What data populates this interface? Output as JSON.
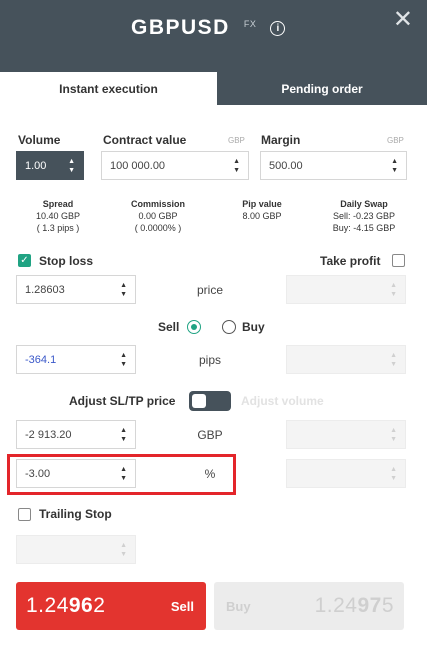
{
  "header": {
    "symbol": "GBPUSD",
    "badge": "FX",
    "info_glyph": "i",
    "close_glyph": "✕"
  },
  "tabs": [
    {
      "label": "Instant execution",
      "active": true
    },
    {
      "label": "Pending order",
      "active": false
    }
  ],
  "volume": {
    "label": "Volume",
    "value": "1.00"
  },
  "contract": {
    "label": "Contract value",
    "currency": "GBP",
    "value": "100 000.00"
  },
  "margin": {
    "label": "Margin",
    "currency": "GBP",
    "value": "500.00"
  },
  "stats": {
    "spread": {
      "label": "Spread",
      "line1": "10.40 GBP",
      "line2": "( 1.3 pips )"
    },
    "commission": {
      "label": "Commission",
      "line1": "0.00 GBP",
      "line2": "( 0.0000% )"
    },
    "pip_value": {
      "label": "Pip value",
      "line1": "8.00 GBP"
    },
    "daily_swap": {
      "label": "Daily Swap",
      "line1": "Sell: -0.23 GBP",
      "line2": "Buy: -4.15 GBP"
    }
  },
  "stop_loss": {
    "label": "Stop loss",
    "checked": true,
    "check_glyph": "✓"
  },
  "take_profit": {
    "label": "Take profit",
    "checked": false
  },
  "row_price": {
    "sl_value": "1.28603",
    "label": "price"
  },
  "side": {
    "sell_label": "Sell",
    "buy_label": "Buy",
    "selected": "Sell"
  },
  "row_pips": {
    "sl_value": "-364.1",
    "label": "pips"
  },
  "adjust": {
    "sl_tp_label": "Adjust SL/TP price",
    "volume_label": "Adjust volume"
  },
  "row_gbp": {
    "sl_value": "-2 913.20",
    "label": "GBP"
  },
  "row_pct": {
    "sl_value": "-3.00",
    "label": "%"
  },
  "trailing": {
    "label": "Trailing Stop",
    "checked": false
  },
  "sell_button": {
    "price_pre": "1.24",
    "price_big": "96",
    "price_post": "2",
    "label": "Sell",
    "color": "#e3342f"
  },
  "buy_button": {
    "price_pre": "1.24",
    "price_big": "97",
    "price_post": "5",
    "label": "Buy"
  },
  "spinner": {
    "up": "▲",
    "down": "▼"
  },
  "colors": {
    "header_bg": "#46525b",
    "accent_green": "#20a383",
    "highlight_red": "#e3252a"
  }
}
